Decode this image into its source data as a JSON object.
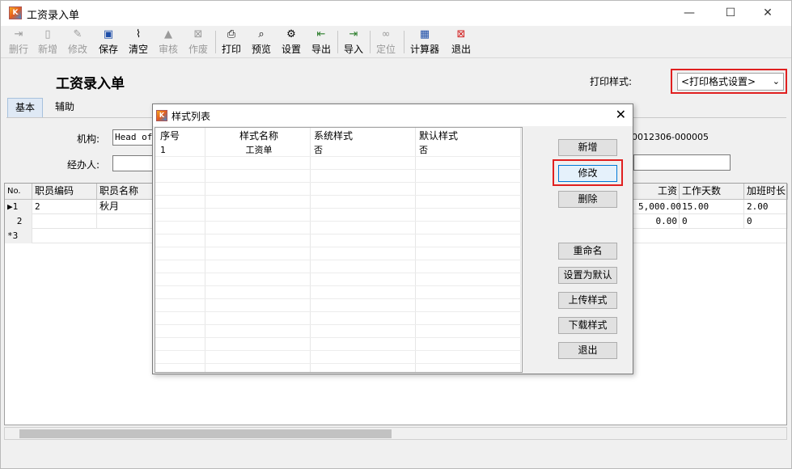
{
  "window": {
    "title": "工资录入单",
    "minimize": "—",
    "maximize": "☐",
    "close": "✕"
  },
  "toolbar": {
    "delete_row": "删行",
    "new": "新增",
    "edit": "修改",
    "save": "保存",
    "clear": "清空",
    "audit": "审核",
    "void": "作废",
    "print": "打印",
    "preview": "预览",
    "settings": "设置",
    "export": "导出",
    "import": "导入",
    "locate": "定位",
    "calculator": "计算器",
    "exit": "退出"
  },
  "form": {
    "title": "工资录入单",
    "print_style_label": "打印样式:",
    "print_style_value": "<打印格式设置>",
    "tabs": [
      "基本",
      "辅助"
    ],
    "org_label": "机构:",
    "org_value": "Head of",
    "handler_label": "经办人:",
    "handler_value": "",
    "doc_no": "0012306-000005"
  },
  "grid": {
    "headers": {
      "no": "No.",
      "emp_code": "职员编码",
      "emp_name": "职员名称",
      "salary": "工资",
      "work_days": "工作天数",
      "overtime": "加班时长"
    },
    "rows": [
      {
        "marker": "▶1",
        "emp_code": "2",
        "emp_name": "秋月",
        "salary": "5,000.00",
        "work_days": "15.00",
        "overtime": "2.00"
      },
      {
        "marker": "2",
        "emp_code": "",
        "emp_name": "",
        "salary": "0.00",
        "work_days": "0",
        "overtime": "0"
      },
      {
        "marker": "*3",
        "emp_code": "",
        "emp_name": "",
        "salary": "",
        "work_days": "",
        "overtime": ""
      }
    ]
  },
  "dialog": {
    "title": "样式列表",
    "close": "✕",
    "columns": {
      "seq": "序号",
      "name": "样式名称",
      "system": "系统样式",
      "default": "默认样式"
    },
    "rows": [
      {
        "seq": "1",
        "name": "工资单",
        "system": "否",
        "default": "否"
      }
    ],
    "buttons": {
      "new": "新增",
      "edit": "修改",
      "delete": "删除",
      "rename": "重命名",
      "set_default": "设置为默认",
      "upload": "上传样式",
      "download": "下载样式",
      "exit": "退出"
    }
  },
  "colors": {
    "highlight": "#e02020",
    "focus": "#0078d7"
  }
}
